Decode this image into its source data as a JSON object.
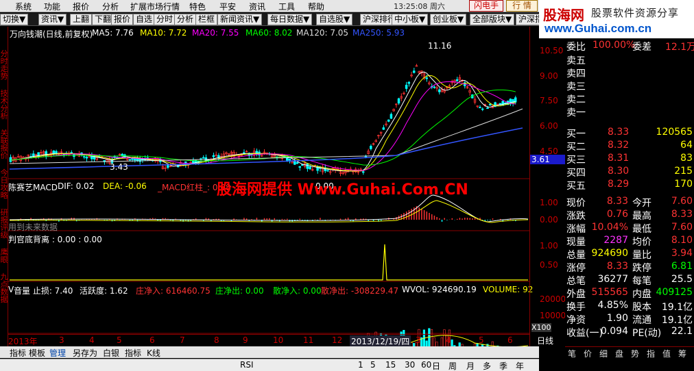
{
  "menu": {
    "items": [
      "系统",
      "功能",
      "报价",
      "分析",
      "扩展市场行情",
      "特色",
      "平安",
      "资讯",
      "工具",
      "帮助"
    ],
    "clock": "13:25:08 周六",
    "flash_btn": "闪电手",
    "news_btn": "行  情"
  },
  "toolbar": [
    "切换▼",
    "资讯▼",
    "上翻",
    "下翻",
    "报价",
    "自选",
    "分时",
    "分析",
    "栏框",
    "新闻资讯▼",
    "每日数据▼",
    "自选股▼",
    "沪深排行",
    "中小板▼",
    "创业板▼",
    "全部版块▼",
    "沪深指"
  ],
  "logo": {
    "cn": "股海网",
    "slogan": "股票软件资源分享",
    "url": "www.Guhai.com.cn"
  },
  "left_tabs": [
    "分时走势",
    "技术分析",
    "关联报价",
    "今日攻略",
    "研报评级",
    "鹰眼",
    "九点数据"
  ],
  "main": {
    "title": "万向钱潮(日线,前复权)",
    "ma": [
      {
        "label": "MA5: 7.76",
        "color": "#ffffff"
      },
      {
        "label": "MA10: 7.72",
        "color": "#ffff00"
      },
      {
        "label": "MA20: 7.55",
        "color": "#ff00ff"
      },
      {
        "label": "MA60: 8.02",
        "color": "#00ff00"
      },
      {
        "label": "MA120: 7.05",
        "color": "#dddddd"
      },
      {
        "label": "MA250: 5.93",
        "color": "#3355ff"
      }
    ],
    "high_marker": "11.16",
    "low_marker": "3.43",
    "price_tag": "3.61",
    "axis_labels": [
      "10.50",
      "9.00",
      "7.50",
      "6.00",
      "4.50"
    ]
  },
  "macd": {
    "title": "陈赛艺MACD",
    "dif": "DIF: 0.02",
    "dea": "DEA: -0.06",
    "hist": "_MACD红柱_: 0.08",
    "extra": "0.00",
    "note": "用到未来数据",
    "axis_labels": [
      "1.00",
      "0.00"
    ]
  },
  "watermark": "股海网提供 Www.Guhai.Com.CN",
  "judge": {
    "title": "判官底背离 : 0.00 : 0.00",
    "axis_labels": [
      "1.00",
      "0.50"
    ]
  },
  "volume": {
    "title": "V",
    "fields": [
      {
        "label": "音量  止损: 7.40",
        "color": "#ffffff"
      },
      {
        "label": "活跃度: 1.62",
        "color": "#ffffff"
      },
      {
        "label": "庄净入: 616460.75",
        "color": "#ff3333"
      },
      {
        "label": "庄净出: 0.00",
        "color": "#00ff00"
      },
      {
        "label": "散净入: 0.00",
        "color": "#00ff00"
      },
      {
        "label": "散净出: -308229.47",
        "color": "#ff3333"
      },
      {
        "label": "WVOL: 924690.19",
        "color": "#ffffff"
      },
      {
        "label": "VOLUME: 92",
        "color": "#ffff00"
      }
    ],
    "axis_labels": [
      "20000",
      "10000"
    ],
    "unit": "X100"
  },
  "dates": [
    "2013年",
    "3",
    "4",
    "5",
    "6",
    "7",
    "8",
    "9",
    "10",
    "11",
    "12",
    "2013/12/19/四",
    "3",
    "4",
    "5",
    "6"
  ],
  "period": "日线",
  "bottom_tabs": [
    "指标",
    "模板",
    "管理",
    "另存为",
    "白银",
    "指标",
    "K线"
  ],
  "bottom_toolbar": [
    "RSI",
    "1",
    "5",
    "15",
    "30",
    "60",
    "日",
    "周",
    "月",
    "多",
    "季",
    "年"
  ],
  "quote": {
    "wei_bi": "100.00%",
    "wei_cha": "12.1万",
    "sell": [
      {
        "l": "卖五",
        "p": "",
        "v": ""
      },
      {
        "l": "卖四",
        "p": "",
        "v": ""
      },
      {
        "l": "卖三",
        "p": "",
        "v": ""
      },
      {
        "l": "卖二",
        "p": "",
        "v": ""
      },
      {
        "l": "卖一",
        "p": "",
        "v": ""
      }
    ],
    "buy": [
      {
        "l": "买一",
        "p": "8.33",
        "v": "120565"
      },
      {
        "l": "买二",
        "p": "8.32",
        "v": "64"
      },
      {
        "l": "买三",
        "p": "8.31",
        "v": "83"
      },
      {
        "l": "买四",
        "p": "8.30",
        "v": "215"
      },
      {
        "l": "买五",
        "p": "8.29",
        "v": "170"
      }
    ],
    "stats": [
      {
        "a": "现价",
        "av": "8.33",
        "ac": "#ff3333",
        "b": "今开",
        "bv": "7.60",
        "bc": "#ff3333"
      },
      {
        "a": "涨跌",
        "av": "0.76",
        "ac": "#ff3333",
        "b": "最高",
        "bv": "8.33",
        "bc": "#ff3333"
      },
      {
        "a": "涨幅",
        "av": "10.04%",
        "ac": "#ff3333",
        "b": "最低",
        "bv": "7.60",
        "bc": "#ff3333"
      },
      {
        "a": "现量",
        "av": "2287",
        "ac": "#ff33ff",
        "b": "均价",
        "bv": "8.10",
        "bc": "#ff3333"
      },
      {
        "a": "总量",
        "av": "924690",
        "ac": "#ffff00",
        "b": "量比",
        "bv": "3.94",
        "bc": "#ff3333"
      },
      {
        "a": "涨停",
        "av": "8.33",
        "ac": "#ff3333",
        "b": "跌停",
        "bv": "6.81",
        "bc": "#00ff00"
      },
      {
        "a": "总笔",
        "av": "36277",
        "ac": "#ffffff",
        "b": "每笔",
        "bv": "25.5",
        "bc": "#ffffff"
      },
      {
        "a": "外盘",
        "av": "515565",
        "ac": "#ff3333",
        "b": "内盘",
        "bv": "409125",
        "bc": "#00ff00"
      },
      {
        "a": "换手",
        "av": "4.85%",
        "ac": "#ffffff",
        "b": "股本",
        "bv": "19.1亿",
        "bc": "#ffffff"
      },
      {
        "a": "净资",
        "av": "1.90",
        "ac": "#ffffff",
        "b": "流通",
        "bv": "19.1亿",
        "bc": "#ffffff"
      },
      {
        "a": "收益(一)",
        "av": "0.094",
        "ac": "#ffffff",
        "b": "PE(动)",
        "bv": "22.1",
        "bc": "#ffffff"
      }
    ]
  },
  "panel_tabs": [
    "笔",
    "价",
    "细",
    "盘",
    "势",
    "指",
    "值",
    "筹"
  ],
  "colors": {
    "up": "#ff3333",
    "down": "#00ffff",
    "grid": "#800000"
  }
}
